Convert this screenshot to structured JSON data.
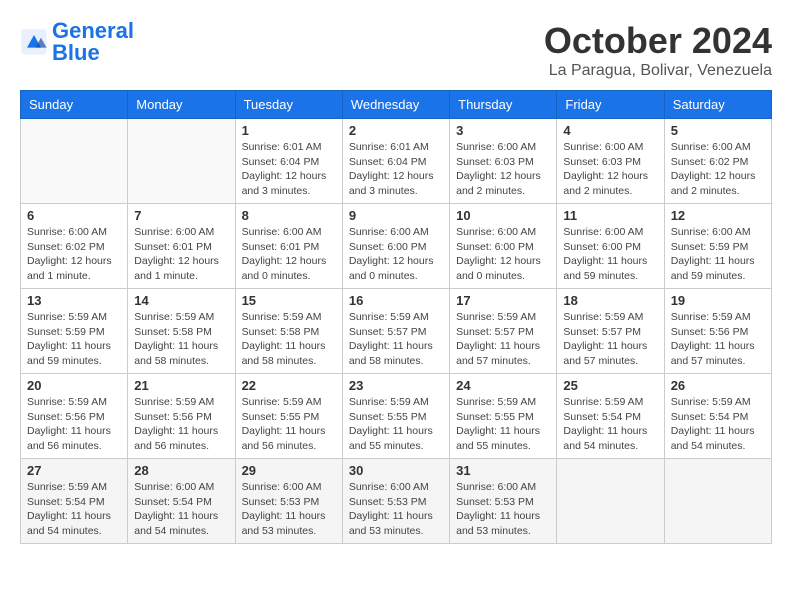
{
  "logo": {
    "text_general": "General",
    "text_blue": "Blue"
  },
  "header": {
    "month_year": "October 2024",
    "location": "La Paragua, Bolivar, Venezuela"
  },
  "weekdays": [
    "Sunday",
    "Monday",
    "Tuesday",
    "Wednesday",
    "Thursday",
    "Friday",
    "Saturday"
  ],
  "weeks": [
    [
      {
        "day": "",
        "info": ""
      },
      {
        "day": "",
        "info": ""
      },
      {
        "day": "1",
        "info": "Sunrise: 6:01 AM\nSunset: 6:04 PM\nDaylight: 12 hours and 3 minutes."
      },
      {
        "day": "2",
        "info": "Sunrise: 6:01 AM\nSunset: 6:04 PM\nDaylight: 12 hours and 3 minutes."
      },
      {
        "day": "3",
        "info": "Sunrise: 6:00 AM\nSunset: 6:03 PM\nDaylight: 12 hours and 2 minutes."
      },
      {
        "day": "4",
        "info": "Sunrise: 6:00 AM\nSunset: 6:03 PM\nDaylight: 12 hours and 2 minutes."
      },
      {
        "day": "5",
        "info": "Sunrise: 6:00 AM\nSunset: 6:02 PM\nDaylight: 12 hours and 2 minutes."
      }
    ],
    [
      {
        "day": "6",
        "info": "Sunrise: 6:00 AM\nSunset: 6:02 PM\nDaylight: 12 hours and 1 minute."
      },
      {
        "day": "7",
        "info": "Sunrise: 6:00 AM\nSunset: 6:01 PM\nDaylight: 12 hours and 1 minute."
      },
      {
        "day": "8",
        "info": "Sunrise: 6:00 AM\nSunset: 6:01 PM\nDaylight: 12 hours and 0 minutes."
      },
      {
        "day": "9",
        "info": "Sunrise: 6:00 AM\nSunset: 6:00 PM\nDaylight: 12 hours and 0 minutes."
      },
      {
        "day": "10",
        "info": "Sunrise: 6:00 AM\nSunset: 6:00 PM\nDaylight: 12 hours and 0 minutes."
      },
      {
        "day": "11",
        "info": "Sunrise: 6:00 AM\nSunset: 6:00 PM\nDaylight: 11 hours and 59 minutes."
      },
      {
        "day": "12",
        "info": "Sunrise: 6:00 AM\nSunset: 5:59 PM\nDaylight: 11 hours and 59 minutes."
      }
    ],
    [
      {
        "day": "13",
        "info": "Sunrise: 5:59 AM\nSunset: 5:59 PM\nDaylight: 11 hours and 59 minutes."
      },
      {
        "day": "14",
        "info": "Sunrise: 5:59 AM\nSunset: 5:58 PM\nDaylight: 11 hours and 58 minutes."
      },
      {
        "day": "15",
        "info": "Sunrise: 5:59 AM\nSunset: 5:58 PM\nDaylight: 11 hours and 58 minutes."
      },
      {
        "day": "16",
        "info": "Sunrise: 5:59 AM\nSunset: 5:57 PM\nDaylight: 11 hours and 58 minutes."
      },
      {
        "day": "17",
        "info": "Sunrise: 5:59 AM\nSunset: 5:57 PM\nDaylight: 11 hours and 57 minutes."
      },
      {
        "day": "18",
        "info": "Sunrise: 5:59 AM\nSunset: 5:57 PM\nDaylight: 11 hours and 57 minutes."
      },
      {
        "day": "19",
        "info": "Sunrise: 5:59 AM\nSunset: 5:56 PM\nDaylight: 11 hours and 57 minutes."
      }
    ],
    [
      {
        "day": "20",
        "info": "Sunrise: 5:59 AM\nSunset: 5:56 PM\nDaylight: 11 hours and 56 minutes."
      },
      {
        "day": "21",
        "info": "Sunrise: 5:59 AM\nSunset: 5:56 PM\nDaylight: 11 hours and 56 minutes."
      },
      {
        "day": "22",
        "info": "Sunrise: 5:59 AM\nSunset: 5:55 PM\nDaylight: 11 hours and 56 minutes."
      },
      {
        "day": "23",
        "info": "Sunrise: 5:59 AM\nSunset: 5:55 PM\nDaylight: 11 hours and 55 minutes."
      },
      {
        "day": "24",
        "info": "Sunrise: 5:59 AM\nSunset: 5:55 PM\nDaylight: 11 hours and 55 minutes."
      },
      {
        "day": "25",
        "info": "Sunrise: 5:59 AM\nSunset: 5:54 PM\nDaylight: 11 hours and 54 minutes."
      },
      {
        "day": "26",
        "info": "Sunrise: 5:59 AM\nSunset: 5:54 PM\nDaylight: 11 hours and 54 minutes."
      }
    ],
    [
      {
        "day": "27",
        "info": "Sunrise: 5:59 AM\nSunset: 5:54 PM\nDaylight: 11 hours and 54 minutes."
      },
      {
        "day": "28",
        "info": "Sunrise: 6:00 AM\nSunset: 5:54 PM\nDaylight: 11 hours and 54 minutes."
      },
      {
        "day": "29",
        "info": "Sunrise: 6:00 AM\nSunset: 5:53 PM\nDaylight: 11 hours and 53 minutes."
      },
      {
        "day": "30",
        "info": "Sunrise: 6:00 AM\nSunset: 5:53 PM\nDaylight: 11 hours and 53 minutes."
      },
      {
        "day": "31",
        "info": "Sunrise: 6:00 AM\nSunset: 5:53 PM\nDaylight: 11 hours and 53 minutes."
      },
      {
        "day": "",
        "info": ""
      },
      {
        "day": "",
        "info": ""
      }
    ]
  ]
}
